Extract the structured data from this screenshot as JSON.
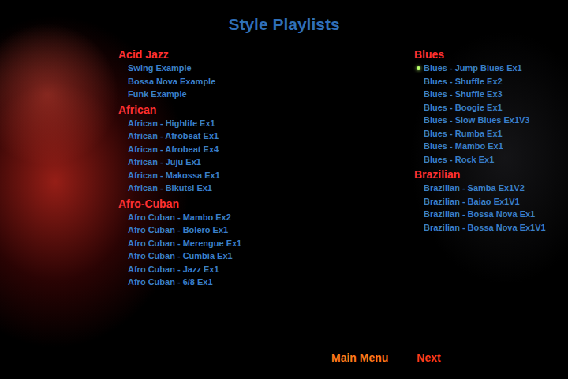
{
  "title": "Style Playlists",
  "columns": [
    {
      "categories": [
        {
          "name": "Acid Jazz",
          "items": [
            {
              "label": "Swing Example",
              "selected": false
            },
            {
              "label": "Bossa Nova Example",
              "selected": false
            },
            {
              "label": "Funk Example",
              "selected": false
            }
          ]
        },
        {
          "name": "African",
          "items": [
            {
              "label": "African - Highlife Ex1",
              "selected": false
            },
            {
              "label": "African - Afrobeat Ex1",
              "selected": false
            },
            {
              "label": "African - Afrobeat Ex4",
              "selected": false
            },
            {
              "label": "African - Juju Ex1",
              "selected": false
            },
            {
              "label": "African - Makossa Ex1",
              "selected": false
            },
            {
              "label": "African - Bikutsi Ex1",
              "selected": false
            }
          ]
        },
        {
          "name": "Afro-Cuban",
          "items": [
            {
              "label": "Afro Cuban - Mambo Ex2",
              "selected": false
            },
            {
              "label": "Afro Cuban - Bolero Ex1",
              "selected": false
            },
            {
              "label": "Afro Cuban - Merengue Ex1",
              "selected": false
            },
            {
              "label": "Afro Cuban - Cumbia Ex1",
              "selected": false
            },
            {
              "label": "Afro Cuban - Jazz Ex1",
              "selected": false
            },
            {
              "label": "Afro Cuban - 6/8 Ex1",
              "selected": false
            }
          ]
        }
      ]
    },
    {
      "categories": [
        {
          "name": "Blues",
          "items": [
            {
              "label": "Blues - Jump Blues Ex1",
              "selected": true
            },
            {
              "label": "Blues - Shuffle Ex2",
              "selected": false
            },
            {
              "label": "Blues - Shuffle Ex3",
              "selected": false
            },
            {
              "label": "Blues - Boogie Ex1",
              "selected": false
            },
            {
              "label": "Blues - Slow Blues Ex1V3",
              "selected": false
            },
            {
              "label": "Blues - Rumba Ex1",
              "selected": false
            },
            {
              "label": "Blues - Mambo Ex1",
              "selected": false
            },
            {
              "label": "Blues - Rock Ex1",
              "selected": false
            }
          ]
        },
        {
          "name": "Brazilian",
          "items": [
            {
              "label": "Brazilian - Samba Ex1V2",
              "selected": false
            },
            {
              "label": "Brazilian - Baiao Ex1V1",
              "selected": false
            },
            {
              "label": "Brazilian - Bossa Nova Ex1",
              "selected": false
            },
            {
              "label": "Brazilian - Bossa Nova Ex1V1",
              "selected": false
            }
          ]
        }
      ]
    }
  ],
  "nav": [
    {
      "label": "Main Menu",
      "color": "#ff7a1a"
    },
    {
      "label": "Next",
      "color": "#ff3b1a"
    }
  ]
}
